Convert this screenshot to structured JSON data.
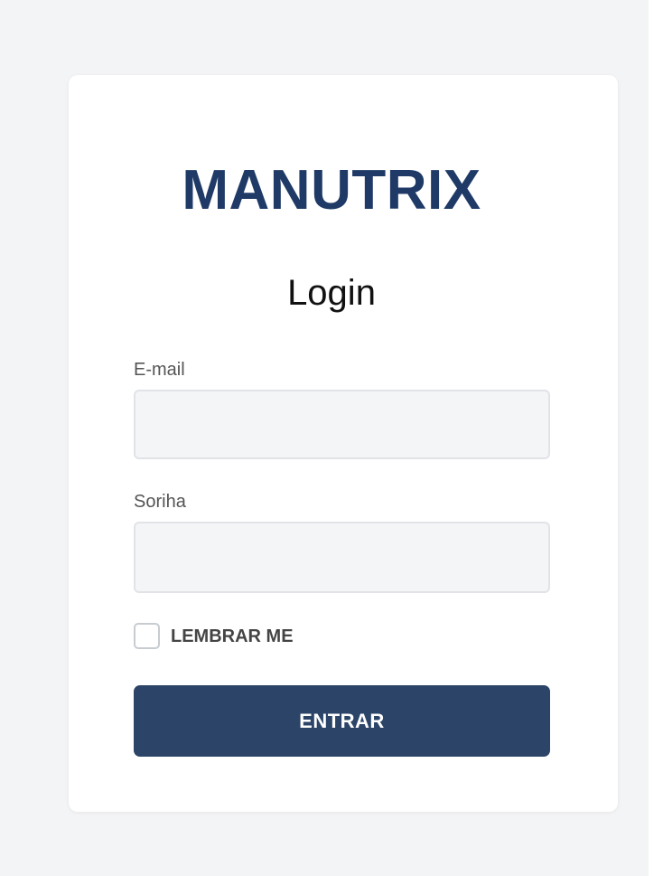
{
  "brand": {
    "name": "MANUTRIX"
  },
  "login": {
    "title": "Login",
    "email": {
      "label": "E-mail",
      "value": "",
      "placeholder": ""
    },
    "password": {
      "label": "Soriha",
      "value": "",
      "placeholder": ""
    },
    "remember": {
      "label": "LEMBRAR ME",
      "checked": false
    },
    "submit_label": "ENTRAR"
  },
  "colors": {
    "background": "#f3f4f5",
    "card": "#ffffff",
    "brand": "#1f3a66",
    "button": "#2b4468",
    "input_background": "#f4f5f7",
    "input_border": "#e1e3e6"
  }
}
